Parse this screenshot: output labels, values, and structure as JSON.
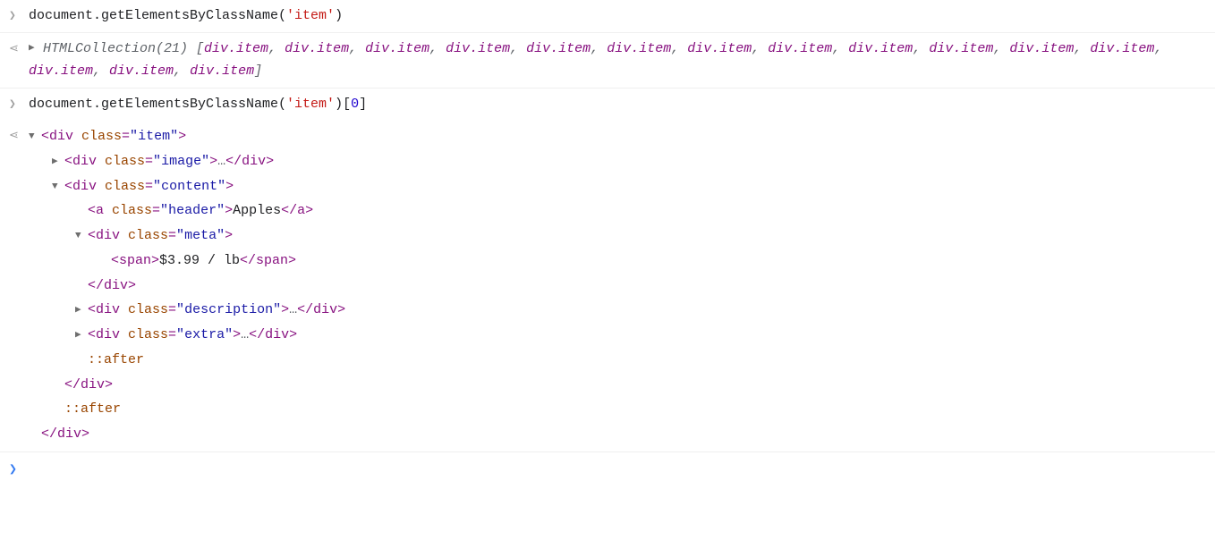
{
  "line1": {
    "code_pre": "document.getElementsByClassName(",
    "arg": "'item'",
    "code_post": ")"
  },
  "line2": {
    "type_label": "HTMLCollection(21)",
    "open": " [",
    "item": "div.item",
    "sep": ", ",
    "close": "]",
    "count": 15
  },
  "line3": {
    "code_pre": "document.getElementsByClassName(",
    "arg": "'item'",
    "code_post": ")[",
    "idx": "0",
    "code_post2": "]"
  },
  "tree": {
    "open_div": "<div ",
    "open_div_noattr_close": ">",
    "class_key": "class",
    "eq": "=",
    "q": "\"",
    "gt": ">",
    "close_div": "</div>",
    "open_a": "<a ",
    "close_a": "</a>",
    "open_span": "<span>",
    "close_span": "</span>",
    "ellipsis": "…",
    "pseudo_after": "::after",
    "vals": {
      "item": "item",
      "image": "image",
      "content": "content",
      "header": "header",
      "meta": "meta",
      "description": "description",
      "extra": "extra"
    },
    "a_text": "Apples",
    "span_text": "$3.99 / lb"
  },
  "arrows": {
    "right": "▶",
    "down": "▼"
  }
}
